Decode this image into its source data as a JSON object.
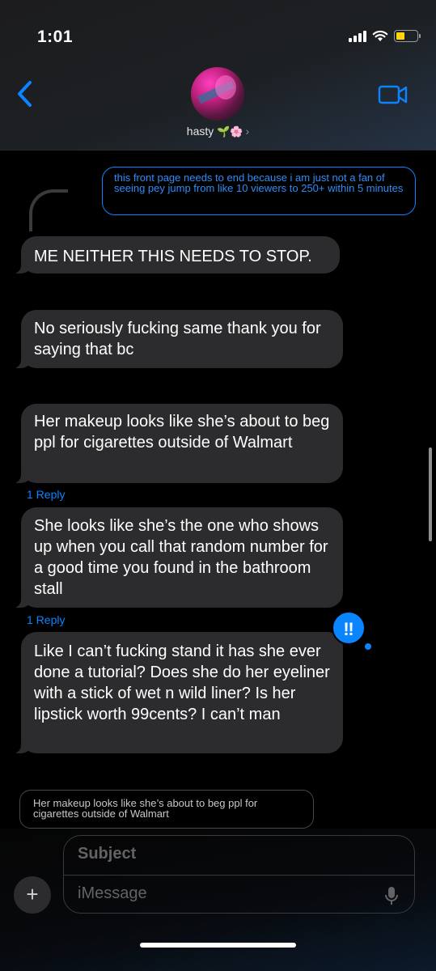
{
  "status_bar": {
    "time": "1:01"
  },
  "contact": {
    "name": "hasty",
    "emoji": "🌱🌸",
    "chevron": "›"
  },
  "messages": {
    "quoted_outgoing": "this front page needs to end because i am just not a fan of seeing pey jump from like 10 viewers to 250+ within 5 minutes",
    "m1": "ME NEITHER THIS NEEDS TO STOP.",
    "m2": "No seriously fucking same thank you for saying that bc",
    "m3": "Her makeup looks like she’s about to beg ppl for cigarettes outside of Walmart",
    "reply1": "1 Reply",
    "m4": "She looks like she’s the one who shows up when you call that random number for a good time you found in the bathroom stall",
    "reply2": "1 Reply",
    "tapback": "‼",
    "m5": "Like I can’t fucking stand it has she ever done a tutorial? Does she do her eyeliner with a stick of wet n wild liner? Is her lipstick worth 99cents? I can’t man",
    "quoted_incoming": "Her makeup looks like she’s about to beg ppl for cigarettes outside of Walmart"
  },
  "composer": {
    "subject_placeholder": "Subject",
    "message_placeholder": "iMessage",
    "plus": "+"
  },
  "colors": {
    "accent": "#0a84ff",
    "bubble_gray": "#2c2c2e",
    "battery": "#ffd60a"
  },
  "icons": [
    "back-chevron-icon",
    "video-camera-icon",
    "signal-icon",
    "wifi-icon",
    "battery-icon",
    "microphone-icon",
    "plus-icon"
  ]
}
